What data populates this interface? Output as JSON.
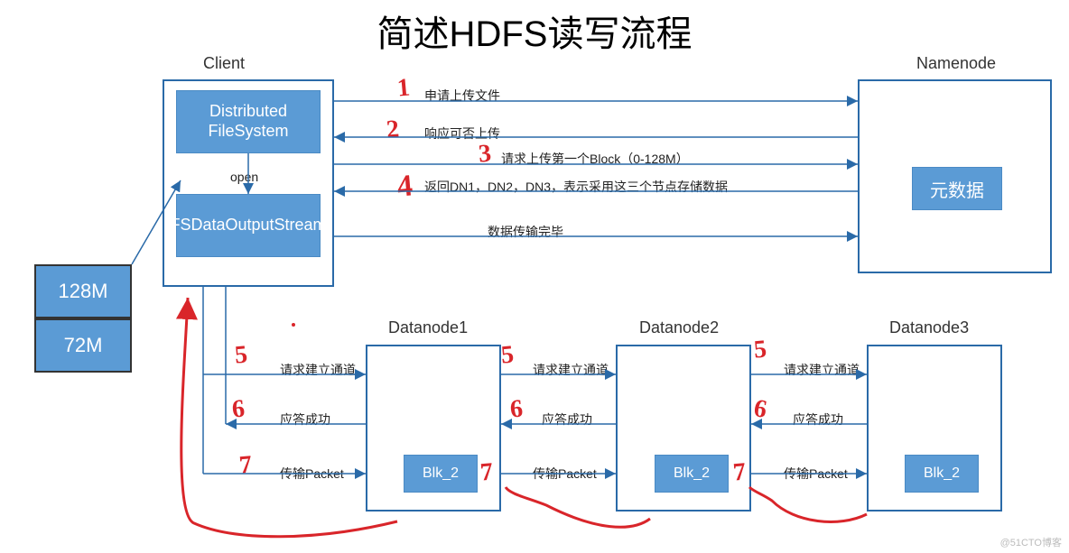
{
  "title": "简述HDFS读写流程",
  "labels": {
    "client": "Client",
    "namenode": "Namenode",
    "open": "open",
    "datanode1": "Datanode1",
    "datanode2": "Datanode2",
    "datanode3": "Datanode3"
  },
  "boxes": {
    "distributed_fs": "Distributed FileSystem",
    "fs_stream": "FSDataOutputStream",
    "metadata": "元数据",
    "blk1": "Blk_2",
    "blk2": "Blk_2",
    "blk3": "Blk_2"
  },
  "file": {
    "size1": "128M",
    "size2": "72M"
  },
  "messages": {
    "m1": "申请上传文件",
    "m2": "响应可否上传",
    "m3": "请求上传第一个Block（0-128M）",
    "m4": "返回DN1，DN2，DN3，表示采用这三个节点存储数据",
    "m5": "数据传输完毕",
    "req_channel": "请求建立通道",
    "ack": "应答成功",
    "packet": "传输Packet"
  },
  "annotations": {
    "a1": "1",
    "a2": "2",
    "a3": "3",
    "a4": "4",
    "a5": "5",
    "a6": "6",
    "a7": "7"
  },
  "watermark": "@51CTO博客"
}
